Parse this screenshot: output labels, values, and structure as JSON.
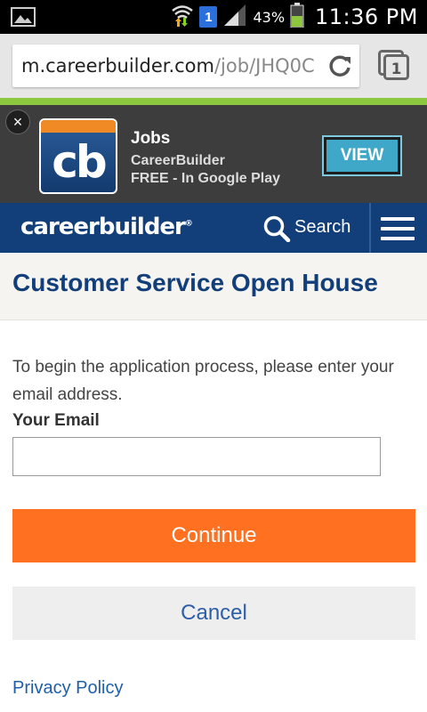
{
  "status_bar": {
    "battery_percent": "43%",
    "time": "11:36 PM",
    "sim_indicator": "1",
    "icons": [
      "gallery-notification-icon",
      "wifi-icon",
      "sim-icon",
      "signal-icon",
      "battery-icon"
    ]
  },
  "browser": {
    "url_domain": "m.careerbuilder.com",
    "url_path": "/job/JHQ0C",
    "tab_count": "1",
    "icons": [
      "reload-icon",
      "tabs-icon"
    ]
  },
  "app_banner": {
    "app_icon_text": "cb",
    "title": "Jobs",
    "publisher": "CareerBuilder",
    "price_line": "FREE - In Google Play",
    "view_label": "VIEW",
    "close_label": "×"
  },
  "site_nav": {
    "logo": "careerbuilder",
    "logo_mark": "®",
    "search_label": "Search",
    "brand_color": "#123f7a"
  },
  "page": {
    "title": "Customer Service Open House",
    "instructions": "To begin the application process, please enter your email address.",
    "email_label": "Your Email",
    "email_value": "",
    "continue_label": "Continue",
    "cancel_label": "Cancel",
    "privacy_label": "Privacy Policy",
    "accent_color": "#ff7021"
  }
}
